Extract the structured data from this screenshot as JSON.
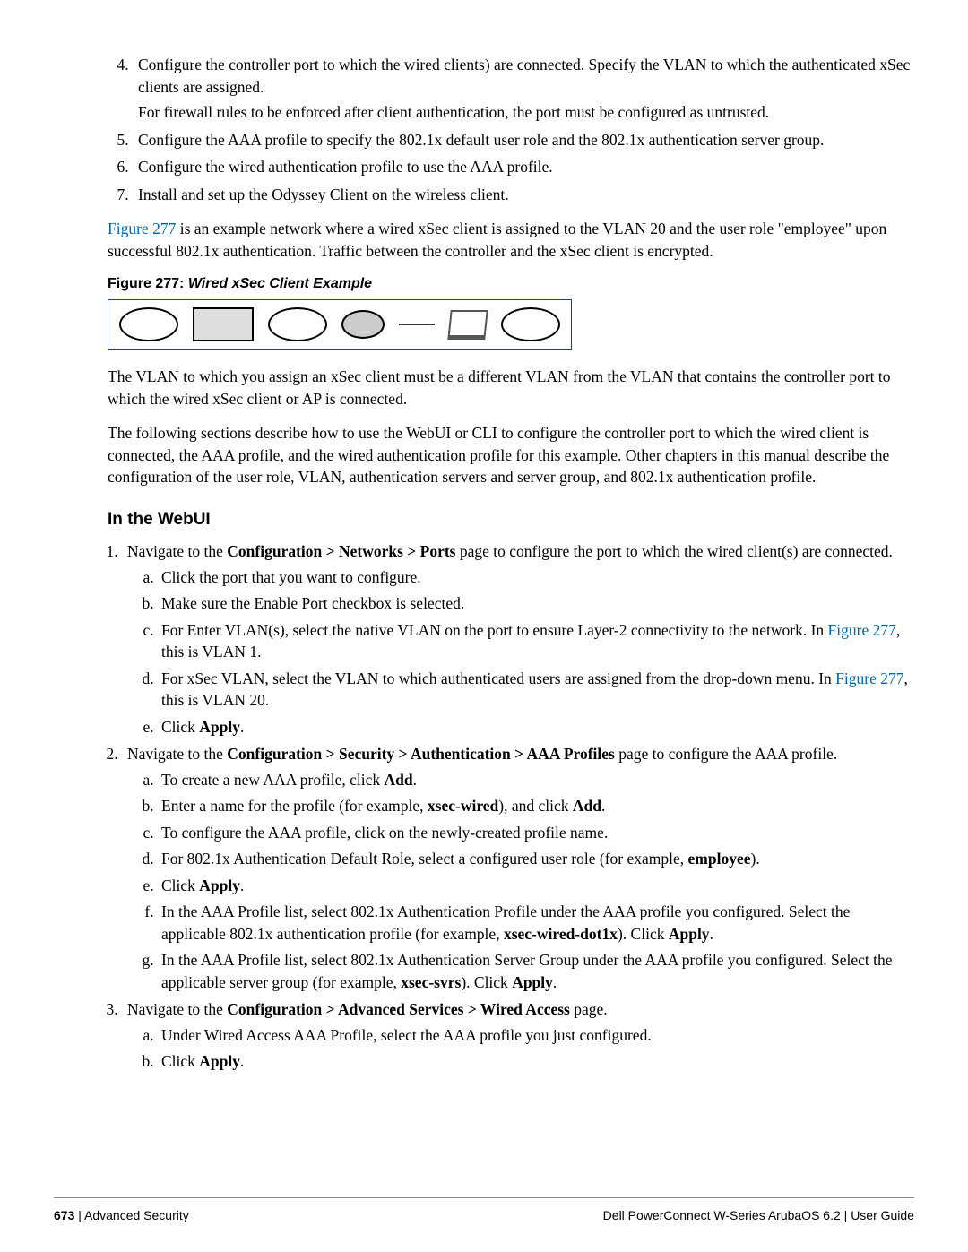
{
  "steps4to7": {
    "s4a": "Configure the controller port to which the wired clients) are connected. Specify the VLAN to which the authenticated xSec clients are assigned.",
    "s4b": "For firewall rules to be enforced after client authentication, the port must be configured as untrusted.",
    "s5": "Configure the AAA profile to specify the 802.1x default user role and the 802.1x authentication server group.",
    "s6": "Configure the wired authentication profile to use the AAA profile.",
    "s7": "Install and set up the Odyssey Client on the wireless client."
  },
  "fig_link": "Figure 277",
  "fig_para": " is an example network where a wired xSec client is assigned to the VLAN 20 and the user role \"employee\" upon successful 802.1x authentication. Traffic between the controller and the xSec client is encrypted.",
  "fig_caption_label": "Figure 277:",
  "fig_caption_title": "Wired xSec Client Example",
  "para_vlan": "The VLAN to which you assign an xSec client must be a different VLAN from the VLAN that contains the controller port to which the wired xSec client or AP is connected.",
  "para_following": "The following sections describe how to use the WebUI or CLI to configure the controller port to which the wired client is connected, the AAA profile, and the wired authentication profile for this example. Other chapters in this manual describe the configuration of the user role, VLAN, authentication servers and server group, and 802.1x authentication profile.",
  "h_webui": "In the WebUI",
  "w1": {
    "pre": "Navigate to the ",
    "path": "Configuration > Networks > Ports",
    "post": " page to configure the port to which the wired client(s) are connected.",
    "a": "Click the port that you want to configure.",
    "b": "Make sure the Enable Port checkbox is selected.",
    "c_pre": "For Enter VLAN(s), select the native VLAN on the port to ensure Layer-2 connectivity to the network. In ",
    "c_post": ", this is VLAN 1.",
    "d_pre": "For xSec VLAN, select the VLAN to which authenticated users are assigned from the drop-down menu. In ",
    "d_post": ", this is VLAN 20.",
    "e_pre": "Click ",
    "apply": "Apply",
    "e_post": "."
  },
  "w2": {
    "pre": "Navigate to the ",
    "path": "Configuration > Security > Authentication > AAA Profiles",
    "post": " page to configure the AAA profile.",
    "a_pre": "To create a new AAA profile, click ",
    "add": "Add",
    "a_post": ".",
    "b_pre": "Enter a name for the profile (for example, ",
    "xw": "xsec-wired",
    "b_mid": "), and click ",
    "b_post": ".",
    "c": "To configure the AAA profile, click on the newly-created profile name.",
    "d_pre": "For 802.1x Authentication Default Role, select a configured user role (for example, ",
    "emp": "employee",
    "d_post": ").",
    "e_pre": "Click ",
    "e_post": ".",
    "f_pre": "In the AAA Profile list, select 802.1x Authentication Profile under the AAA profile you configured. Select the applicable 802.1x authentication profile (for example, ",
    "xwd": "xsec-wired-dot1x",
    "f_mid": "). Click ",
    "f_post": ".",
    "g_pre": "In the AAA Profile list, select 802.1x Authentication Server Group under the AAA profile you configured. Select the applicable server group (for example, ",
    "xs": "xsec-svrs",
    "g_mid": "). Click ",
    "g_post": "."
  },
  "w3": {
    "pre": "Navigate to the ",
    "path": "Configuration > Advanced Services > Wired Access",
    "post": " page.",
    "a": "Under Wired Access AAA Profile, select the AAA profile you just configured.",
    "b_pre": "Click ",
    "b_post": "."
  },
  "footer": {
    "page_num": "673",
    "left_sep": " | ",
    "left_title": "Advanced Security",
    "right_product": "Dell PowerConnect W-Series ArubaOS 6.2",
    "right_sep": "  |  ",
    "right_doc": "User Guide"
  }
}
